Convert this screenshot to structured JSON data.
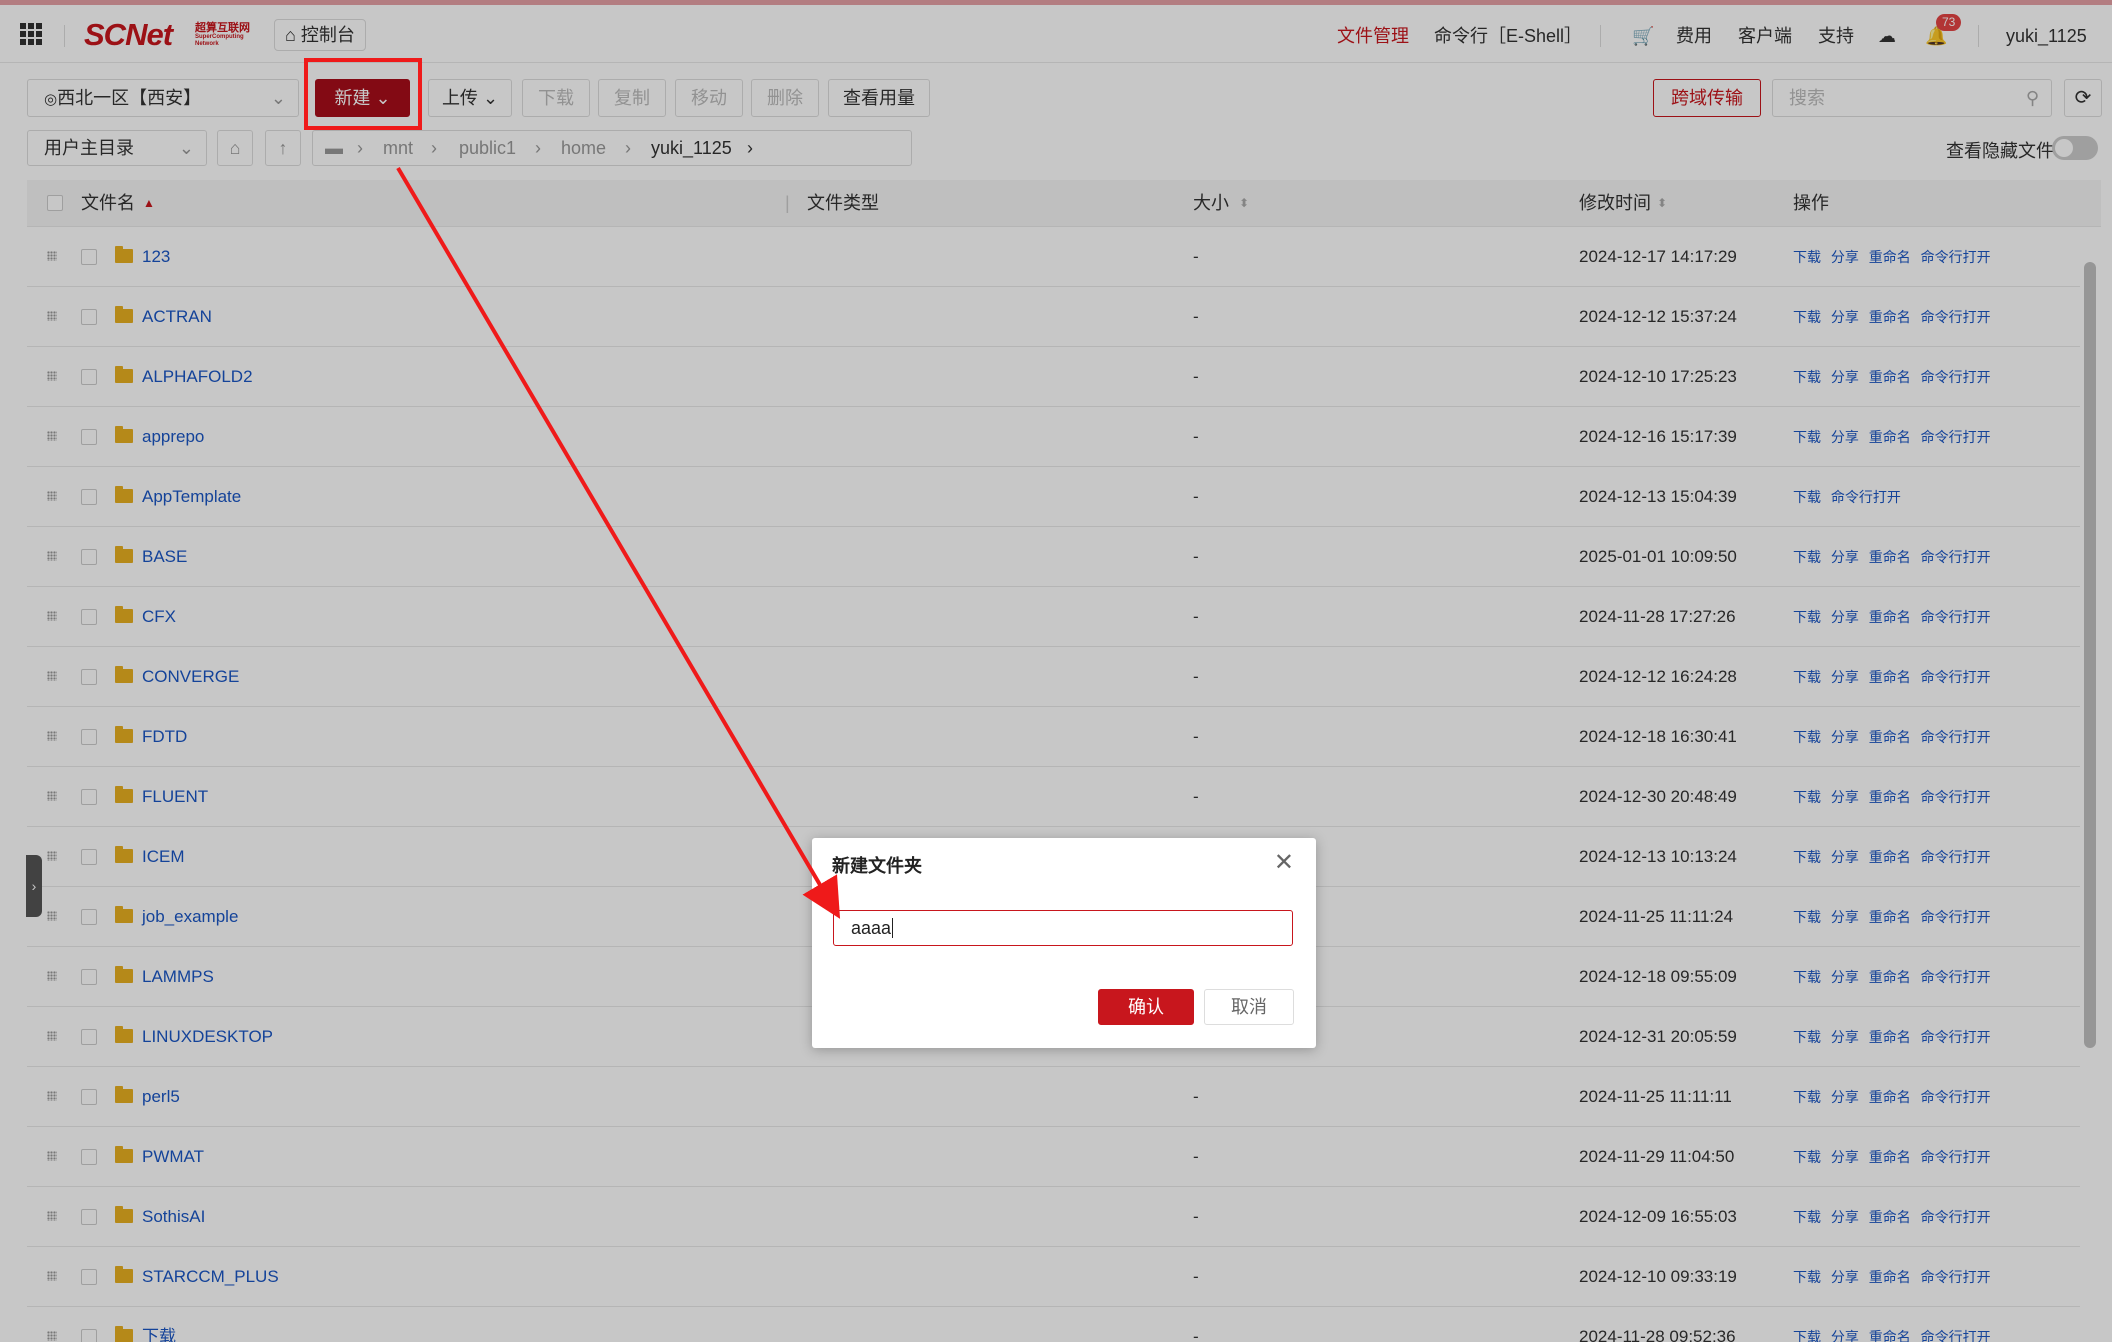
{
  "topbar": {
    "logo": "SCNet",
    "logo_sub1": "超算互联网",
    "logo_sub2": "SuperComputing",
    "logo_sub3": "Network",
    "console": "控制台",
    "nav_file_mgmt": "文件管理",
    "nav_eshell": "命令行［E-Shell］",
    "nav_fee": "费用",
    "nav_client": "客户端",
    "nav_support": "支持",
    "badge_count": "73",
    "username": "yuki_1125"
  },
  "toolbar": {
    "region": "西北一区【西安】",
    "new": "新建",
    "upload": "上传",
    "download": "下载",
    "copy": "复制",
    "move": "移动",
    "delete": "删除",
    "usage": "查看用量",
    "cross_transfer": "跨域传输",
    "search_placeholder": "搜索"
  },
  "pathbar": {
    "root_select": "用户主目录",
    "crumbs": [
      "mnt",
      "public1",
      "home",
      "yuki_1125"
    ],
    "hidden_files": "查看隐藏文件"
  },
  "table": {
    "headers": {
      "name": "文件名",
      "type": "文件类型",
      "size": "大小",
      "mtime": "修改时间",
      "ops": "操作"
    },
    "rows": [
      {
        "name": "123",
        "size": "-",
        "mtime": "2024-12-17 14:17:29",
        "ops": "下载 分享 重命名 命令行打开"
      },
      {
        "name": "ACTRAN",
        "size": "-",
        "mtime": "2024-12-12 15:37:24",
        "ops": "下载 分享 重命名 命令行打开"
      },
      {
        "name": "ALPHAFOLD2",
        "size": "-",
        "mtime": "2024-12-10 17:25:23",
        "ops": "下载 分享 重命名 命令行打开"
      },
      {
        "name": "apprepo",
        "size": "-",
        "mtime": "2024-12-16 15:17:39",
        "ops": "下载 分享 重命名 命令行打开"
      },
      {
        "name": "AppTemplate",
        "size": "-",
        "mtime": "2024-12-13 15:04:39",
        "ops": "下载 命令行打开"
      },
      {
        "name": "BASE",
        "size": "-",
        "mtime": "2025-01-01 10:09:50",
        "ops": "下载 分享 重命名 命令行打开"
      },
      {
        "name": "CFX",
        "size": "-",
        "mtime": "2024-11-28 17:27:26",
        "ops": "下载 分享 重命名 命令行打开"
      },
      {
        "name": "CONVERGE",
        "size": "-",
        "mtime": "2024-12-12 16:24:28",
        "ops": "下载 分享 重命名 命令行打开"
      },
      {
        "name": "FDTD",
        "size": "-",
        "mtime": "2024-12-18 16:30:41",
        "ops": "下载 分享 重命名 命令行打开"
      },
      {
        "name": "FLUENT",
        "size": "-",
        "mtime": "2024-12-30 20:48:49",
        "ops": "下载 分享 重命名 命令行打开"
      },
      {
        "name": "ICEM",
        "size": "",
        "mtime": "2024-12-13 10:13:24",
        "ops": "下载 分享 重命名 命令行打开"
      },
      {
        "name": "job_example",
        "size": "",
        "mtime": "2024-11-25 11:11:24",
        "ops": "下载 分享 重命名 命令行打开"
      },
      {
        "name": "LAMMPS",
        "size": "",
        "mtime": "2024-12-18 09:55:09",
        "ops": "下载 分享 重命名 命令行打开"
      },
      {
        "name": "LINUXDESKTOP",
        "size": "",
        "mtime": "2024-12-31 20:05:59",
        "ops": "下载 分享 重命名 命令行打开"
      },
      {
        "name": "perl5",
        "size": "-",
        "mtime": "2024-11-25 11:11:11",
        "ops": "下载 分享 重命名 命令行打开"
      },
      {
        "name": "PWMAT",
        "size": "-",
        "mtime": "2024-11-29 11:04:50",
        "ops": "下载 分享 重命名 命令行打开"
      },
      {
        "name": "SothisAI",
        "size": "-",
        "mtime": "2024-12-09 16:55:03",
        "ops": "下载 分享 重命名 命令行打开"
      },
      {
        "name": "STARCCM_PLUS",
        "size": "-",
        "mtime": "2024-12-10 09:33:19",
        "ops": "下载 分享 重命名 命令行打开"
      },
      {
        "name": "下载",
        "size": "-",
        "mtime": "2024-11-28 09:52:36",
        "ops": "下载 分享 重命名 命令行打开"
      }
    ]
  },
  "modal": {
    "title": "新建文件夹",
    "input_value": "aaaa",
    "confirm": "确认",
    "cancel": "取消"
  },
  "colors": {
    "brand": "#c8161d",
    "primary_button": "#a80d1a",
    "link": "#1a56c5",
    "annotation": "#ef1a1a",
    "folder": "#e8b020"
  }
}
